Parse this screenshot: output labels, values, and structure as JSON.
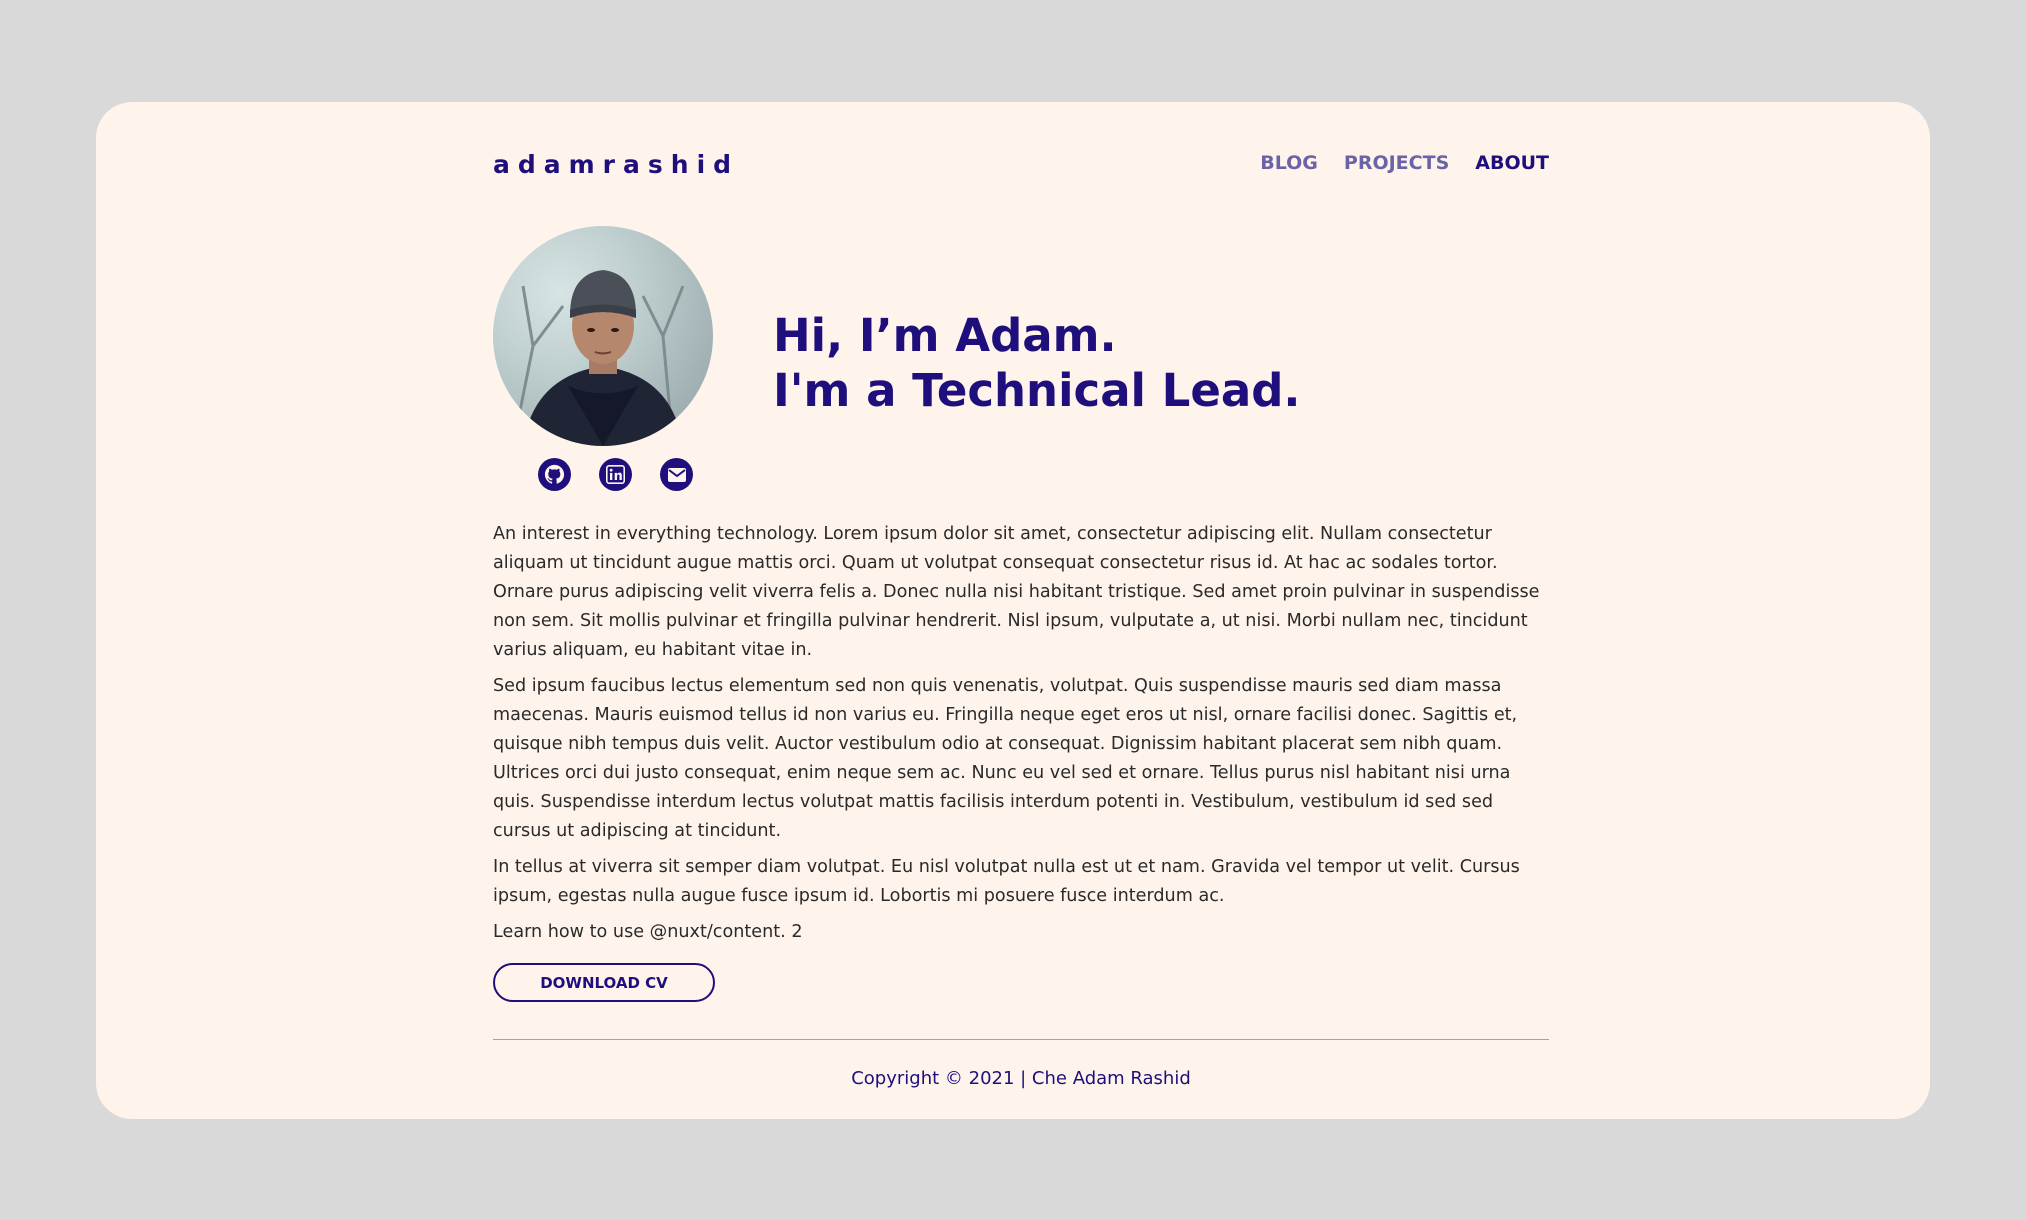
{
  "header": {
    "logo": "adamrashid",
    "nav": [
      {
        "label": "BLOG",
        "active": false
      },
      {
        "label": "PROJECTS",
        "active": false
      },
      {
        "label": "ABOUT",
        "active": true
      }
    ]
  },
  "hero": {
    "headline_line1": "Hi, I’m Adam.",
    "headline_line2": "I'm a Technical Lead.",
    "social": [
      "github-icon",
      "linkedin-icon",
      "email-icon"
    ]
  },
  "content": {
    "paragraphs": [
      "An interest in everything technology. Lorem ipsum dolor sit amet, consectetur adipiscing elit. Nullam consectetur aliquam ut tincidunt augue mattis orci. Quam ut volutpat consequat consectetur risus id. At hac ac sodales tortor. Ornare purus adipiscing velit viverra felis a. Donec nulla nisi habitant tristique. Sed amet proin pulvinar in suspendisse non sem. Sit mollis pulvinar et fringilla pulvinar hendrerit. Nisl ipsum, vulputate a, ut nisi. Morbi nullam nec, tincidunt varius aliquam, eu habitant vitae in.",
      "Sed ipsum faucibus lectus elementum sed non quis venenatis, volutpat. Quis suspendisse mauris sed diam massa maecenas. Mauris euismod tellus id non varius eu. Fringilla neque eget eros ut nisl, ornare facilisi donec. Sagittis et, quisque nibh tempus duis velit. Auctor vestibulum odio at consequat. Dignissim habitant placerat sem nibh quam. Ultrices orci dui justo consequat, enim neque sem ac. Nunc eu vel sed et ornare. Tellus purus nisl habitant nisi urna quis. Suspendisse interdum lectus volutpat mattis facilisis interdum potenti in. Vestibulum, vestibulum id sed sed cursus ut adipiscing at tincidunt.",
      "In tellus at viverra sit semper diam volutpat. Eu nisl volutpat nulla est ut et nam. Gravida vel tempor ut velit. Cursus ipsum, egestas nulla augue fusce ipsum id. Lobortis mi posuere fusce interdum ac.",
      "Learn how to use @nuxt/content. 2"
    ],
    "download_label": "DOWNLOAD CV"
  },
  "footer": {
    "copyright": "Copyright © 2021 | Che Adam Rashid"
  },
  "colors": {
    "background": "#d9d9d9",
    "card": "#fef4ec",
    "accent": "#1e0f7c",
    "nav_inactive": "#6b63a8",
    "text": "#2a2a2a"
  }
}
